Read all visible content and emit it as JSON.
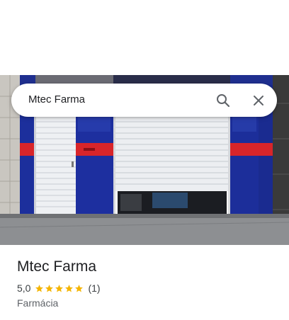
{
  "search": {
    "query": "Mtec Farma"
  },
  "place": {
    "name": "Mtec Farma",
    "rating": "5,0",
    "stars": 5,
    "review_count": "(1)",
    "category": "Farmácia"
  },
  "colors": {
    "star": "#f4b400",
    "text": "#202124",
    "secondary": "#5f6368"
  }
}
